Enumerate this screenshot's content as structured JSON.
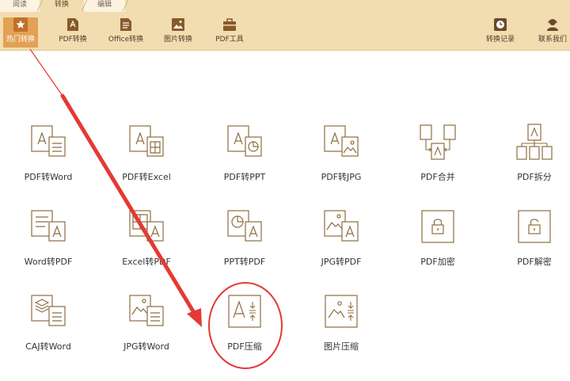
{
  "tabs": [
    {
      "label": "阅读"
    },
    {
      "label": "转换"
    },
    {
      "label": "编辑"
    }
  ],
  "toolbar": {
    "items": [
      {
        "label": "热门转换",
        "icon": "star-icon"
      },
      {
        "label": "PDF转换",
        "icon": "pdf-file-icon"
      },
      {
        "label": "Office转换",
        "icon": "office-document-icon"
      },
      {
        "label": "图片转换",
        "icon": "image-icon"
      },
      {
        "label": "PDF工具",
        "icon": "toolbox-icon"
      }
    ],
    "right_items": [
      {
        "label": "转换记录",
        "icon": "clock-history-icon"
      },
      {
        "label": "联系我们",
        "icon": "support-person-icon"
      }
    ]
  },
  "converters": [
    {
      "label": "PDF转Word",
      "icon": "pdf-to-word-icon"
    },
    {
      "label": "PDF转Excel",
      "icon": "pdf-to-excel-icon"
    },
    {
      "label": "PDF转PPT",
      "icon": "pdf-to-ppt-icon"
    },
    {
      "label": "PDF转JPG",
      "icon": "pdf-to-jpg-icon"
    },
    {
      "label": "PDF合并",
      "icon": "pdf-merge-icon"
    },
    {
      "label": "PDF拆分",
      "icon": "pdf-split-icon"
    },
    {
      "label": "Word转PDF",
      "icon": "word-to-pdf-icon"
    },
    {
      "label": "Excel转PDF",
      "icon": "excel-to-pdf-icon"
    },
    {
      "label": "PPT转PDF",
      "icon": "ppt-to-pdf-icon"
    },
    {
      "label": "JPG转PDF",
      "icon": "jpg-to-pdf-icon"
    },
    {
      "label": "PDF加密",
      "icon": "lock-icon"
    },
    {
      "label": "PDF解密",
      "icon": "unlock-icon"
    },
    {
      "label": "CAJ转Word",
      "icon": "caj-to-word-icon"
    },
    {
      "label": "JPG转Word",
      "icon": "jpg-to-word-icon"
    },
    {
      "label": "PDF压缩",
      "icon": "pdf-compress-icon"
    },
    {
      "label": "图片压缩",
      "icon": "image-compress-icon"
    }
  ],
  "colors": {
    "ribbon": "#f1ddb0",
    "active_tool": "#e2a154",
    "icon_stroke": "#8c6d3f",
    "annotation_red": "#e53935"
  }
}
